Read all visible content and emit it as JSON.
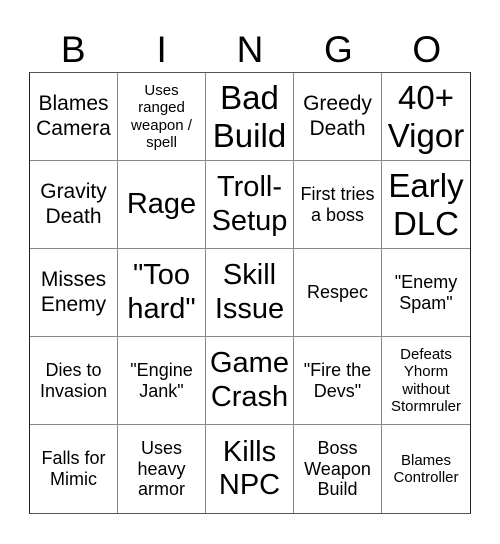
{
  "header": [
    "B",
    "I",
    "N",
    "G",
    "O"
  ],
  "cells": [
    [
      "Blames Camera",
      "Uses ranged weapon / spell",
      "Bad Build",
      "Greedy Death",
      "40+ Vigor"
    ],
    [
      "Gravity Death",
      "Rage",
      "Troll-Setup",
      "First tries a boss",
      "Early DLC"
    ],
    [
      "Misses Enemy",
      "\"Too hard\"",
      "Skill Issue",
      "Respec",
      "\"Enemy Spam\""
    ],
    [
      "Dies to Invasion",
      "\"Engine Jank\"",
      "Game Crash",
      "\"Fire the Devs\"",
      "Defeats Yhorm without Stormruler"
    ],
    [
      "Falls for Mimic",
      "Uses heavy armor",
      "Kills NPC",
      "Boss Weapon Build",
      "Blames Controller"
    ]
  ]
}
